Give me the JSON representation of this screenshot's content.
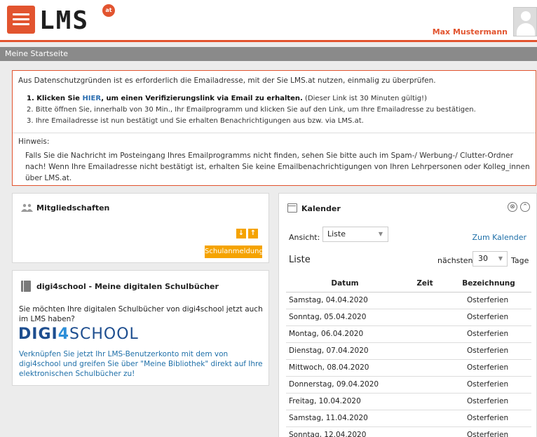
{
  "header": {
    "logo_text": "LMS",
    "logo_badge": "at",
    "user_name": "Max Mustermann"
  },
  "titlebar": {
    "title": "Meine Startseite"
  },
  "notice": {
    "intro": "Aus Datenschutzgründen ist es erforderlich die Emailadresse, mit der Sie LMS.at nutzen, einmalig zu überprüfen.",
    "step1_prefix": "1. Klicken Sie ",
    "step1_link": "HIER",
    "step1_bold_suffix": ", um einen Verifizierungslink via Email zu erhalten.",
    "step1_note": " (Dieser Link ist 30 Minuten gültig!)",
    "step2": "2. Bitte öffnen Sie, innerhalb von 30 Min., Ihr Emailprogramm und klicken Sie auf den Link, um Ihre Emailadresse zu bestätigen.",
    "step3": "3. Ihre Emailadresse ist nun bestätigt und Sie erhalten Benachrichtigungen aus bzw. via LMS.at.",
    "hint_label": "Hinweis:",
    "hint_text": "Falls Sie die Nachricht im Posteingang Ihres Emailprogramms nicht finden, sehen Sie bitte auch im Spam-/ Werbung-/ Clutter-Ordner nach! Wenn Ihre Emailadresse nicht bestätigt ist, erhalten Sie keine Emailbenachrichtigungen von Ihren Lehrpersonen oder Kolleg_innen über LMS.at."
  },
  "members": {
    "title": "Mitgliedschaften",
    "arrow_down": "↓",
    "arrow_up": "↑",
    "school_button": "Schulanmeldung"
  },
  "digi": {
    "title": "digi4school - Meine digitalen Schulbücher",
    "question": "Sie möchten Ihre digitalen Schulbücher von digi4school jetzt auch im LMS haben?",
    "brand_a": "DIGI",
    "brand_b": "4",
    "brand_c": "SCHOOL",
    "link_text": "Verknüpfen Sie jetzt Ihr LMS-Benutzerkonto mit dem von digi4school und greifen Sie über \"Meine Bibliothek\" direkt auf Ihre elektronischen Schulbücher zu!"
  },
  "calendar": {
    "title": "Kalender",
    "close_icon": "⊗",
    "collapse_icon": "⌃",
    "view_label": "Ansicht:",
    "view_value": "Liste",
    "to_calendar": "Zum Kalender",
    "list_heading": "Liste",
    "next_label": "nächsten",
    "next_value": "30",
    "days_label": "Tage",
    "columns": [
      "Datum",
      "Zeit",
      "Bezeichnung"
    ],
    "rows": [
      {
        "date": "Samstag, 04.04.2020",
        "time": "",
        "desc": "Osterferien"
      },
      {
        "date": "Sonntag, 05.04.2020",
        "time": "",
        "desc": "Osterferien"
      },
      {
        "date": "Montag, 06.04.2020",
        "time": "",
        "desc": "Osterferien"
      },
      {
        "date": "Dienstag, 07.04.2020",
        "time": "",
        "desc": "Osterferien"
      },
      {
        "date": "Mittwoch, 08.04.2020",
        "time": "",
        "desc": "Osterferien"
      },
      {
        "date": "Donnerstag, 09.04.2020",
        "time": "",
        "desc": "Osterferien"
      },
      {
        "date": "Freitag, 10.04.2020",
        "time": "",
        "desc": "Osterferien"
      },
      {
        "date": "Samstag, 11.04.2020",
        "time": "",
        "desc": "Osterferien"
      },
      {
        "date": "Sonntag, 12.04.2020",
        "time": "",
        "desc": "Osterferien"
      }
    ]
  }
}
